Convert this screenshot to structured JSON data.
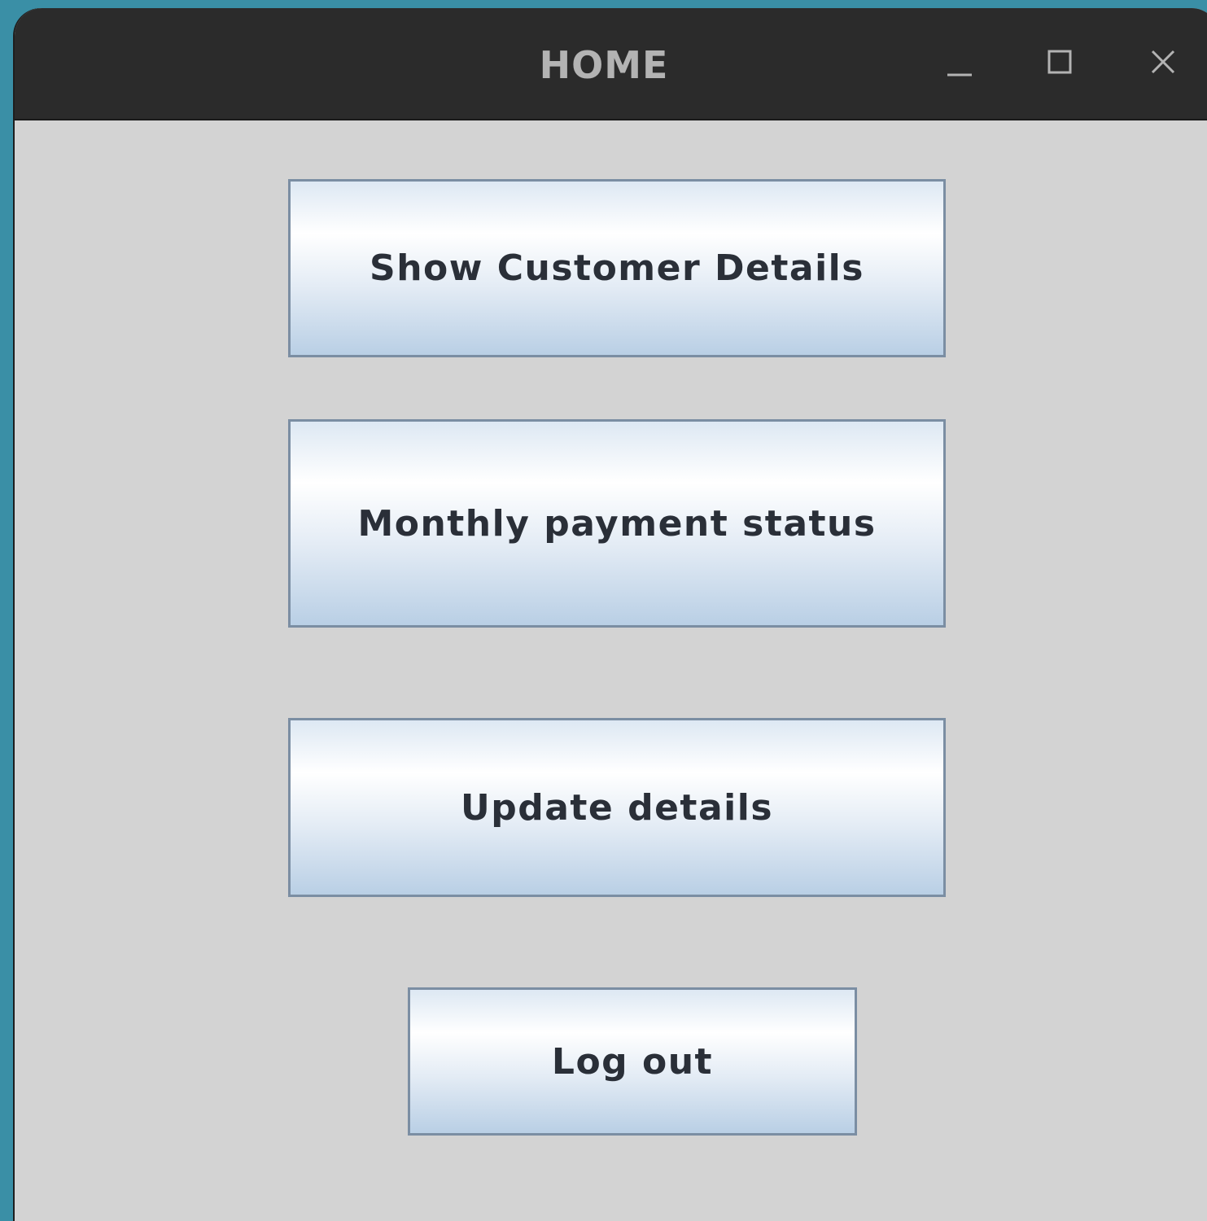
{
  "window": {
    "title": "HOME",
    "controls": {
      "minimize": "minimize-icon",
      "maximize": "maximize-icon",
      "close": "close-icon"
    }
  },
  "buttons": {
    "show_customer_details": "Show Customer Details",
    "monthly_payment_status": "Monthly payment status",
    "update_details": "Update details",
    "log_out": "Log out"
  },
  "colors": {
    "desktop_bg": "#3a8fa6",
    "titlebar_bg": "#2b2b2b",
    "title_text": "#b3b3b3",
    "window_bg": "#d3d3d3",
    "button_border": "#7b8ea3",
    "button_text": "#2a2f38"
  }
}
